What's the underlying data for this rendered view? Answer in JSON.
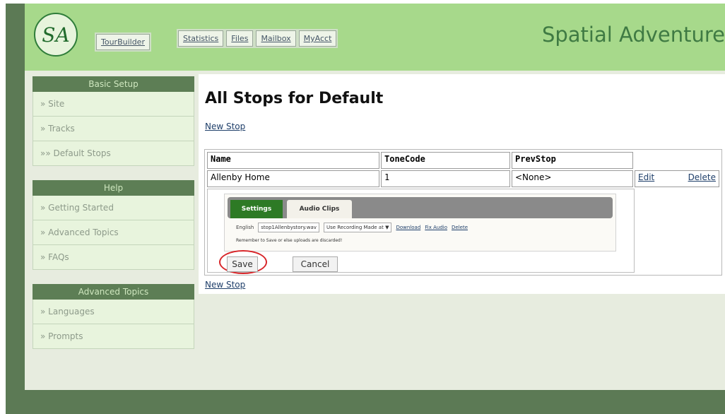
{
  "header": {
    "logo_text": "SA",
    "brand": "Spatial Adventure",
    "nav": {
      "tourbuilder": "TourBuilder",
      "statistics": "Statistics",
      "files": "Files",
      "mailbox": "Mailbox",
      "myacct": "MyAcct"
    }
  },
  "sidebar": {
    "basic_setup": {
      "title": "Basic Setup",
      "items": [
        "» Site",
        "» Tracks",
        "»» Default Stops"
      ]
    },
    "help": {
      "title": "Help",
      "items": [
        "» Getting Started",
        "» Advanced Topics",
        "» FAQs"
      ]
    },
    "advanced_topics": {
      "title": "Advanced Topics",
      "items": [
        "» Languages",
        "» Prompts"
      ]
    }
  },
  "main": {
    "title": "All Stops for Default",
    "new_stop": "New Stop",
    "table": {
      "headers": [
        "Name",
        "ToneCode",
        "PrevStop"
      ],
      "row": {
        "name": "Allenby Home",
        "tonecode": "1",
        "prevstop": "<None>",
        "edit": "Edit",
        "delete": "Delete"
      }
    },
    "editor": {
      "tab_settings": "Settings",
      "tab_audio": "Audio Clips",
      "lang_label": "English",
      "file_value": "stop1Allenbystory.wav",
      "select_value": "Use Recording Made at",
      "download": "Download",
      "fix_audio": "Fix Audio",
      "delete": "Delete",
      "reminder": "Remember to Save or else uploads are discarded!",
      "save": "Save",
      "cancel": "Cancel"
    }
  },
  "colors": {
    "header_green": "#a7d98b",
    "sidebar_head": "#5d7e55",
    "frame": "#5c7a55",
    "highlight_ring": "#d8262a",
    "settings_tab": "#2d7a25"
  }
}
